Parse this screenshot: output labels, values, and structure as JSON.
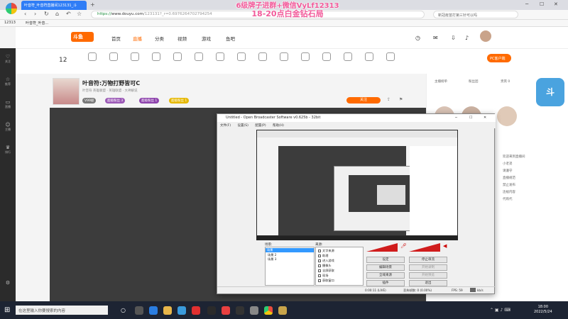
{
  "browser": {
    "tab_title": "叶音符_叶音符直播间123131_斗",
    "address_scheme": "https://",
    "address_host": "www.douyu.com",
    "address_path": "/123131?_r=0.6976264702794254",
    "search_hint": "新冠疫苗打第三针可以吗",
    "bookmarks": [
      "12313",
      "叶音符_叶音..."
    ]
  },
  "overlay": {
    "line1": "6级牌子进群+微信VyLf12313",
    "line2": "18-20点白金钻石局"
  },
  "site": {
    "nav": [
      "首页",
      "直播",
      "分类",
      "视频",
      "游戏",
      "鱼吧"
    ],
    "categories": [
      "",
      "",
      "",
      "",
      "",
      "",
      "",
      "",
      "",
      "",
      "",
      "",
      "",
      "",
      ""
    ],
    "count": "12",
    "pc_client": "PC客户端"
  },
  "sidebar": {
    "items": [
      "关注",
      "推荐",
      "直播",
      "主播",
      "排行"
    ]
  },
  "stream": {
    "title": "叶音符:万物打野皆可C",
    "meta": "叶音符    英雄联盟 · 英雄联盟 · 大神解说",
    "badges": [
      "V99级",
      "超级粉丝 3",
      "超级粉丝 1",
      "超级粉丝 1"
    ],
    "follow": "关注"
  },
  "right_panel": {
    "lines": [
      "主播榜单",
      "粉丝团",
      "贵宾 0",
      "欢迎来到直播间",
      "小老弟",
      "请遵守",
      "直播规范",
      "禁止发布",
      "违规内容",
      "代购代"
    ]
  },
  "obs": {
    "title": "Untitled - Open Broadcaster Software v0.625b - 32bit",
    "menu": [
      "文件(F)",
      "设置(S)",
      "配置(P)",
      "帮助(H)"
    ],
    "scenes_label": "场景:",
    "scenes": [
      "场景",
      "场景 2",
      "场景 3"
    ],
    "sources_label": "来源:",
    "sources": [
      "文字来源",
      "助理",
      "进入游戏",
      "摄像头",
      "全屏获取",
      "现场",
      "获取窗口"
    ],
    "buttons": {
      "settings": "设定",
      "stop_stream": "停止串流",
      "edit_scene": "编辑场景",
      "start_recording": "开始录制",
      "global_sources": "全域来源",
      "preview": "开始预览",
      "plugins": "插件",
      "exit": "退出"
    },
    "status": {
      "time": "0:00:11 (LIVE)",
      "dropped": "丢失帧数: 0 (0.00%)",
      "fps": "FPS: 59",
      "bitrate": "kb/s"
    }
  },
  "taskbar": {
    "search_placeholder": "在这里输入你要搜索的内容",
    "time": "18:00",
    "date": "2022/5/24"
  }
}
